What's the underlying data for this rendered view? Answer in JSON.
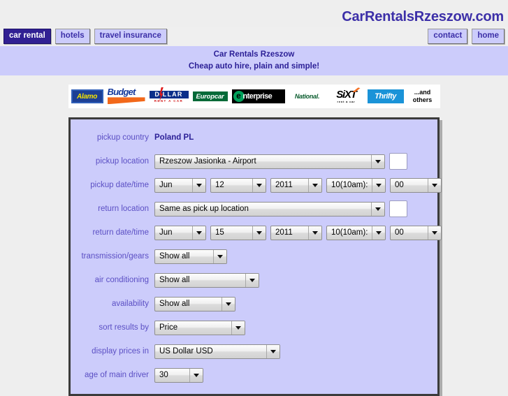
{
  "header": {
    "site_title": "CarRentalsRzeszow.com"
  },
  "nav": {
    "left_items": [
      {
        "label": "car rental",
        "active": true
      },
      {
        "label": "hotels",
        "active": false
      },
      {
        "label": "travel insurance",
        "active": false
      }
    ],
    "right_items": [
      {
        "label": "contact"
      },
      {
        "label": "home"
      }
    ]
  },
  "tagline": {
    "line1": "Car Rentals Rzeszow",
    "line2": "Cheap auto hire, plain and simple!"
  },
  "logos": [
    {
      "name": "alamo-logo",
      "text": "Alamo"
    },
    {
      "name": "budget-logo",
      "text": "Budget"
    },
    {
      "name": "dollar-logo",
      "text": "D LLAR",
      "sub": "RENT A CAR"
    },
    {
      "name": "europcar-logo",
      "text": "Europcar"
    },
    {
      "name": "enterprise-logo",
      "mark": "e",
      "text": "nterprise"
    },
    {
      "name": "national-logo",
      "text": "National."
    },
    {
      "name": "sixt-logo",
      "text": "SiXT",
      "sub": "rent a car"
    },
    {
      "name": "thrifty-logo",
      "text": "Thrifty"
    },
    {
      "name": "and-others-label",
      "line1": "...and",
      "line2": "others"
    }
  ],
  "form": {
    "pickup_country": {
      "label": "pickup country",
      "value": "Poland PL"
    },
    "pickup_location": {
      "label": "pickup location",
      "value": "Rzeszow Jasionka - Airport"
    },
    "pickup_datetime": {
      "label": "pickup date/time",
      "month": "Jun",
      "day": "12",
      "year": "2011",
      "hour": "10(10am):",
      "minute": "00"
    },
    "return_location": {
      "label": "return location",
      "value": "Same as pick up location"
    },
    "return_datetime": {
      "label": "return date/time",
      "month": "Jun",
      "day": "15",
      "year": "2011",
      "hour": "10(10am):",
      "minute": "00"
    },
    "transmission": {
      "label": "transmission/gears",
      "value": "Show all"
    },
    "air_conditioning": {
      "label": "air conditioning",
      "value": "Show all"
    },
    "availability": {
      "label": "availability",
      "value": "Show all"
    },
    "sort_results_by": {
      "label": "sort results by",
      "value": "Price"
    },
    "display_prices_in": {
      "label": "display prices in",
      "value": "US Dollar USD"
    },
    "age_of_main_driver": {
      "label": "age of main driver",
      "value": "30"
    }
  },
  "colors": {
    "accent_purple": "#3c2fa8",
    "band_lavender": "#ccccfb",
    "active_nav": "#312093",
    "page_bg": "#eeeeee"
  }
}
